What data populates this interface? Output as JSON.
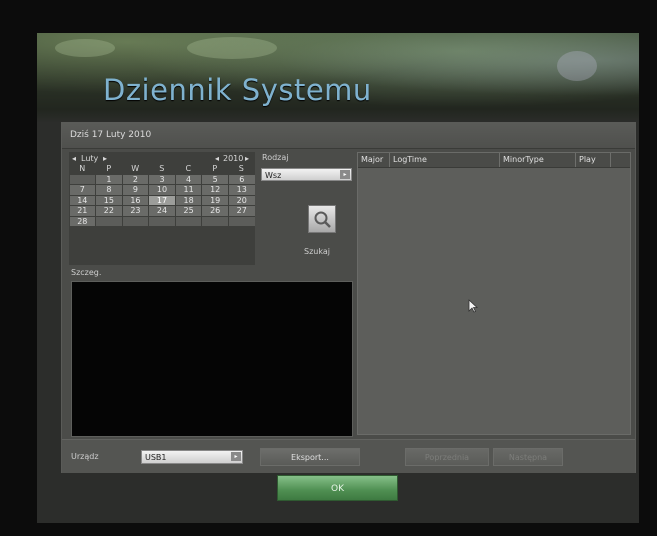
{
  "title": "Dziennik Systemu",
  "date_label": "Dziś 17 Luty 2010",
  "calendar": {
    "month": "Luty",
    "year": "2010",
    "weekdays": [
      "N",
      "P",
      "W",
      "S",
      "C",
      "P",
      "S"
    ],
    "weeks": [
      [
        "",
        "1",
        "2",
        "3",
        "4",
        "5",
        "6"
      ],
      [
        "7",
        "8",
        "9",
        "10",
        "11",
        "12",
        "13"
      ],
      [
        "14",
        "15",
        "16",
        "17",
        "18",
        "19",
        "20"
      ],
      [
        "21",
        "22",
        "23",
        "24",
        "25",
        "26",
        "27"
      ],
      [
        "28",
        "",
        "",
        "",
        "",
        "",
        ""
      ]
    ],
    "selected_day": "17"
  },
  "type_filter": {
    "label": "Rodzaj",
    "value": "Wsz"
  },
  "search_label": "Szukaj",
  "detail_label": "Szczeg.",
  "log_table": {
    "columns": [
      "Major",
      "LogTime",
      "MinorType",
      "Play"
    ]
  },
  "device": {
    "label": "Urządz",
    "value": "USB1"
  },
  "buttons": {
    "export": "Eksport...",
    "previous": "Poprzednia",
    "next": "Następna",
    "ok": "OK"
  }
}
